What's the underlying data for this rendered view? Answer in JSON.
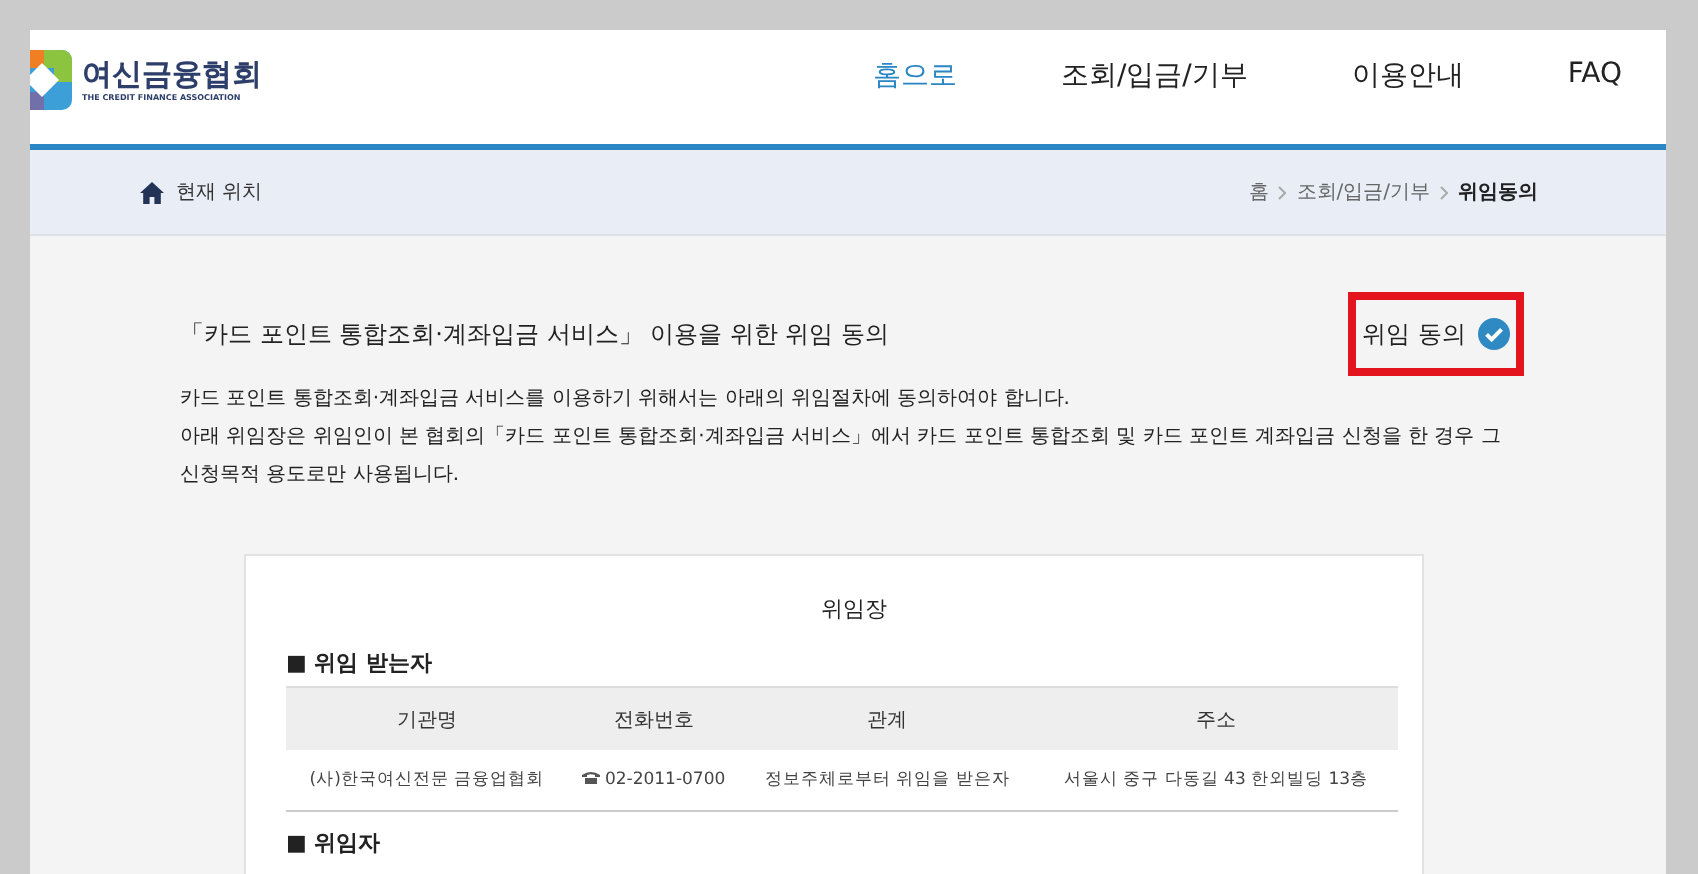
{
  "logo": {
    "name": "여신금융협회",
    "subtitle": "THE CREDIT FINANCE ASSOCIATION"
  },
  "nav": [
    {
      "label": "홈으로",
      "selected": true
    },
    {
      "label": "조회/입금/기부",
      "selected": false
    },
    {
      "label": "이용안내",
      "selected": false
    },
    {
      "label": "FAQ",
      "selected": false
    }
  ],
  "location": {
    "label": "현재 위치",
    "breadcrumb": [
      {
        "label": "홈",
        "current": false
      },
      {
        "label": "조회/입금/기부",
        "current": false
      },
      {
        "label": "위임동의",
        "current": true
      }
    ]
  },
  "heading": "「카드 포인트 통합조회·계좌입금 서비스」 이용을 위한 위임 동의",
  "consent": {
    "label": "위임 동의",
    "checked": true
  },
  "paragraphs": [
    "카드 포인트 통합조회·계좌입금 서비스를 이용하기 위해서는 아래의 위임절차에 동의하여야 합니다.",
    "아래 위임장은 위임인이 본 협회의「카드 포인트 통합조회·계좌입금 서비스」에서 카드 포인트 통합조회 및 카드 포인트 계좌입금 신청을 한 경우 그 신청목적 용도로만 사용됩니다."
  ],
  "letter": {
    "title": "위임장",
    "sections": [
      {
        "title": "■ 위임 받는자",
        "table": {
          "columns": [
            "기관명",
            "전화번호",
            "관계",
            "주소"
          ],
          "rows": [
            {
              "cells": [
                "(사)한국여신전문 금융업협회",
                "02-2011-0700",
                "정보주체로부터 위임을 받은자",
                "서울시 중구 다동길 43 한외빌딩 13층"
              ]
            }
          ]
        }
      },
      {
        "title": "■ 위임자"
      }
    ]
  }
}
